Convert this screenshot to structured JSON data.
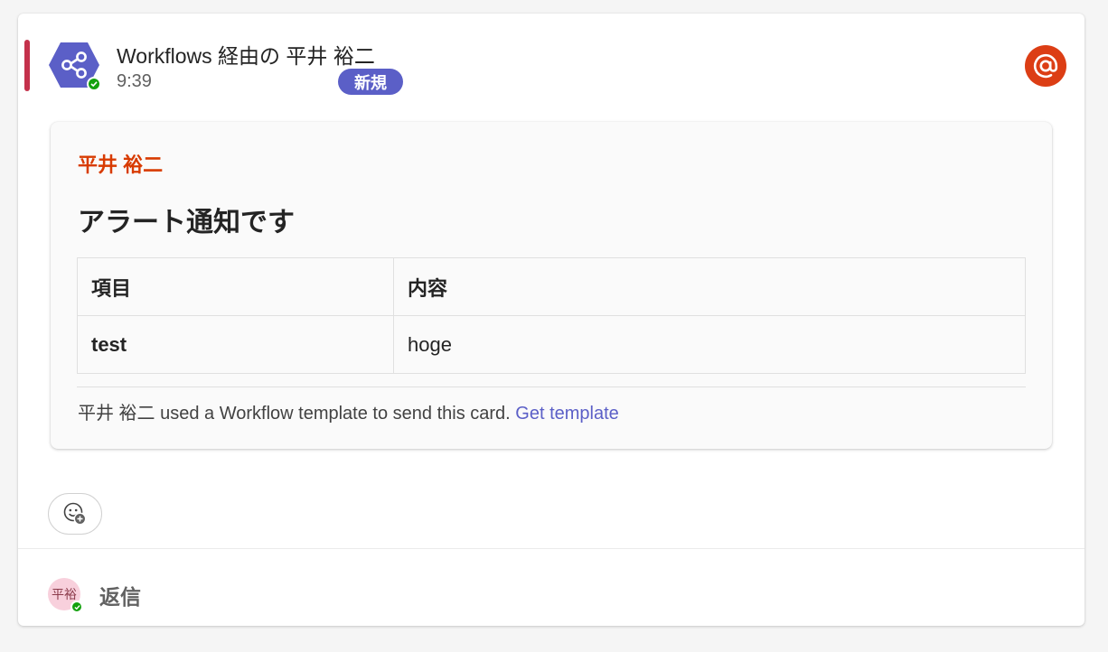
{
  "message": {
    "sender": "Workflows 経由の 平井 裕二",
    "time": "9:39",
    "badge": "新規",
    "mention_icon": "at-mention-icon",
    "colors": {
      "mention_bar": "#c4314b",
      "badge": "#5b5fc7",
      "mention_icon": "#dc3e15",
      "bot_avatar": "#5b5fc7",
      "presence": "#13a10e"
    }
  },
  "card": {
    "author": "平井 裕二",
    "title": "アラート通知です",
    "table": {
      "headers": [
        "項目",
        "内容"
      ],
      "rows": [
        [
          "test",
          "hoge"
        ]
      ]
    },
    "footer_text": "平井 裕二 used a Workflow template to send this card.",
    "footer_link": "Get template",
    "colors": {
      "author": "#d83b01",
      "link": "#5b5fc7"
    }
  },
  "reactions": {
    "add_icon": "add-reaction-icon"
  },
  "reply": {
    "avatar_initials": "平裕",
    "label": "返信"
  }
}
